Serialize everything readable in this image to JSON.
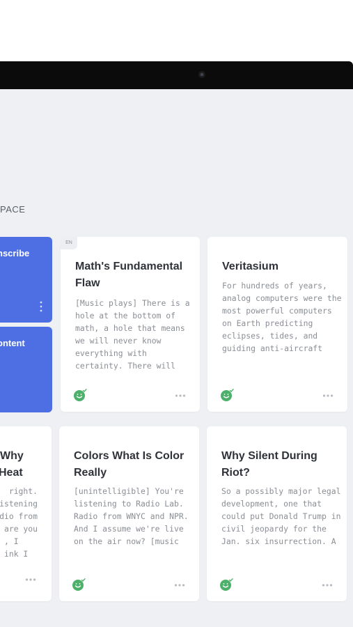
{
  "section": {
    "label": "PACE"
  },
  "blue_cards": [
    {
      "label": "nscribe"
    },
    {
      "label": "ontent"
    }
  ],
  "cards": [
    {
      "lang": "EN",
      "title": "Math's Fundamental Flaw",
      "excerpt": "[Music plays] There is a hole at the bottom of math, a hole that means we will never know everything with certainty. There will always be true"
    },
    {
      "title": "Veritasium",
      "excerpt": "For hundreds of years, analog computers were the most powerful computers on Earth predicting eclipses, tides, and guiding anti-aircraft guns. Then, [slow music"
    },
    {
      "title": "Colors What Is Color Really",
      "excerpt": "[unintelligible] You're listening to Radio Lab. Radio from WNYC and NPR. And I assume we're live on the air now? [music"
    },
    {
      "title": "Why Silent During Riot?",
      "excerpt": "So a possibly major legal development, one that could put Donald Trump in civil jeopardy for the Jan. six insurrection. A"
    }
  ],
  "partial_card": {
    "title_lines": [
      "Why",
      "Heat"
    ],
    "excerpt_lines": [
      "right.",
      "istening",
      "dio from",
      "are you",
      ", I",
      "ink I"
    ]
  },
  "colors": {
    "accent": "#4e6fe3",
    "smile": "#4caf6a"
  }
}
